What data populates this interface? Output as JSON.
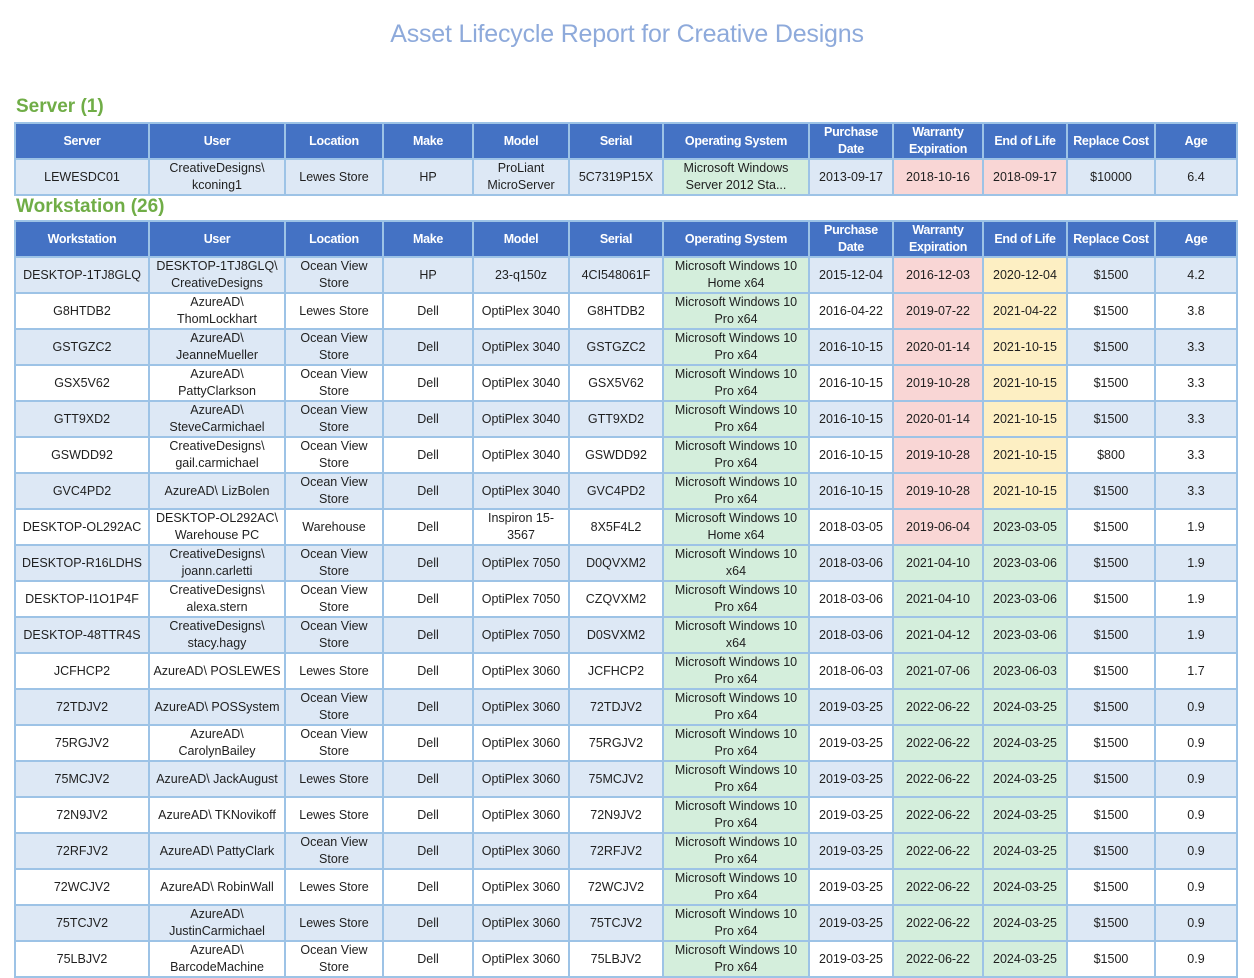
{
  "title": "Asset Lifecycle Report for Creative Designs",
  "colors": {
    "header_bg": "#4472c4",
    "title": "#8eaadb",
    "section": "#70ad47",
    "red": "#f9d6d5",
    "yellow": "#fdefc3",
    "green": "#d4eedc"
  },
  "server_section": {
    "heading": "Server (1)",
    "columns": [
      "Server",
      "User",
      "Location",
      "Make",
      "Model",
      "Serial",
      "Operating System",
      "Purchase Date",
      "Warranty Expiration",
      "End of Life",
      "Replace Cost",
      "Age"
    ],
    "rows": [
      {
        "name": "LEWESDC01",
        "user": "CreativeDesigns\\ kconing1",
        "location": "Lewes Store",
        "make": "HP",
        "model": "ProLiant MicroServer",
        "serial": "5C7319P15X",
        "os": "Microsoft Windows Server 2012 Sta...",
        "purchase": "2013-09-17",
        "warranty": "2018-10-16",
        "warranty_status": "red",
        "eol": "2018-09-17",
        "eol_status": "red",
        "cost": "$10000",
        "age": "6.4"
      }
    ]
  },
  "workstation_section": {
    "heading": "Workstation (26)",
    "columns": [
      "Workstation",
      "User",
      "Location",
      "Make",
      "Model",
      "Serial",
      "Operating System",
      "Purchase Date",
      "Warranty Expiration",
      "End of Life",
      "Replace Cost",
      "Age"
    ],
    "rows": [
      {
        "name": "DESKTOP-1TJ8GLQ",
        "user": "DESKTOP-1TJ8GLQ\\ CreativeDesigns",
        "location": "Ocean View Store",
        "make": "HP",
        "model": "23-q150z",
        "serial": "4CI548061F",
        "os": "Microsoft Windows 10 Home x64",
        "purchase": "2015-12-04",
        "warranty": "2016-12-03",
        "warranty_status": "red",
        "eol": "2020-12-04",
        "eol_status": "yel",
        "cost": "$1500",
        "age": "4.2"
      },
      {
        "name": "G8HTDB2",
        "user": "AzureAD\\ ThomLockhart",
        "location": "Lewes Store",
        "make": "Dell",
        "model": "OptiPlex 3040",
        "serial": "G8HTDB2",
        "os": "Microsoft Windows 10 Pro x64",
        "purchase": "2016-04-22",
        "warranty": "2019-07-22",
        "warranty_status": "red",
        "eol": "2021-04-22",
        "eol_status": "yel",
        "cost": "$1500",
        "age": "3.8"
      },
      {
        "name": "GSTGZC2",
        "user": "AzureAD\\ JeanneMueller",
        "location": "Ocean View Store",
        "make": "Dell",
        "model": "OptiPlex 3040",
        "serial": "GSTGZC2",
        "os": "Microsoft Windows 10 Pro x64",
        "purchase": "2016-10-15",
        "warranty": "2020-01-14",
        "warranty_status": "red",
        "eol": "2021-10-15",
        "eol_status": "yel",
        "cost": "$1500",
        "age": "3.3"
      },
      {
        "name": "GSX5V62",
        "user": "AzureAD\\ PattyClarkson",
        "location": "Ocean View Store",
        "make": "Dell",
        "model": "OptiPlex 3040",
        "serial": "GSX5V62",
        "os": "Microsoft Windows 10 Pro x64",
        "purchase": "2016-10-15",
        "warranty": "2019-10-28",
        "warranty_status": "red",
        "eol": "2021-10-15",
        "eol_status": "yel",
        "cost": "$1500",
        "age": "3.3"
      },
      {
        "name": "GTT9XD2",
        "user": "AzureAD\\ SteveCarmichael",
        "location": "Ocean View Store",
        "make": "Dell",
        "model": "OptiPlex 3040",
        "serial": "GTT9XD2",
        "os": "Microsoft Windows 10 Pro x64",
        "purchase": "2016-10-15",
        "warranty": "2020-01-14",
        "warranty_status": "red",
        "eol": "2021-10-15",
        "eol_status": "yel",
        "cost": "$1500",
        "age": "3.3"
      },
      {
        "name": "GSWDD92",
        "user": "CreativeDesigns\\ gail.carmichael",
        "location": "Ocean View Store",
        "make": "Dell",
        "model": "OptiPlex 3040",
        "serial": "GSWDD92",
        "os": "Microsoft Windows 10 Pro x64",
        "purchase": "2016-10-15",
        "warranty": "2019-10-28",
        "warranty_status": "red",
        "eol": "2021-10-15",
        "eol_status": "yel",
        "cost": "$800",
        "age": "3.3"
      },
      {
        "name": "GVC4PD2",
        "user": "AzureAD\\ LizBolen",
        "location": "Ocean View Store",
        "make": "Dell",
        "model": "OptiPlex 3040",
        "serial": "GVC4PD2",
        "os": "Microsoft Windows 10 Pro x64",
        "purchase": "2016-10-15",
        "warranty": "2019-10-28",
        "warranty_status": "red",
        "eol": "2021-10-15",
        "eol_status": "yel",
        "cost": "$1500",
        "age": "3.3"
      },
      {
        "name": "DESKTOP-OL292AC",
        "user": "DESKTOP-OL292AC\\ Warehouse PC",
        "location": "Warehouse",
        "make": "Dell",
        "model": "Inspiron 15-3567",
        "serial": "8X5F4L2",
        "os": "Microsoft Windows 10 Home x64",
        "purchase": "2018-03-05",
        "warranty": "2019-06-04",
        "warranty_status": "red",
        "eol": "2023-03-05",
        "eol_status": "grn",
        "cost": "$1500",
        "age": "1.9"
      },
      {
        "name": "DESKTOP-R16LDHS",
        "user": "CreativeDesigns\\ joann.carletti",
        "location": "Ocean View Store",
        "make": "Dell",
        "model": "OptiPlex 7050",
        "serial": "D0QVXM2",
        "os": "Microsoft Windows 10 x64",
        "purchase": "2018-03-06",
        "warranty": "2021-04-10",
        "warranty_status": "grn",
        "eol": "2023-03-06",
        "eol_status": "grn",
        "cost": "$1500",
        "age": "1.9"
      },
      {
        "name": "DESKTOP-I1O1P4F",
        "user": "CreativeDesigns\\ alexa.stern",
        "location": "Ocean View Store",
        "make": "Dell",
        "model": "OptiPlex 7050",
        "serial": "CZQVXM2",
        "os": "Microsoft Windows 10 Pro x64",
        "purchase": "2018-03-06",
        "warranty": "2021-04-10",
        "warranty_status": "grn",
        "eol": "2023-03-06",
        "eol_status": "grn",
        "cost": "$1500",
        "age": "1.9"
      },
      {
        "name": "DESKTOP-48TTR4S",
        "user": "CreativeDesigns\\ stacy.hagy",
        "location": "Ocean View Store",
        "make": "Dell",
        "model": "OptiPlex 7050",
        "serial": "D0SVXM2",
        "os": "Microsoft Windows 10 x64",
        "purchase": "2018-03-06",
        "warranty": "2021-04-12",
        "warranty_status": "grn",
        "eol": "2023-03-06",
        "eol_status": "grn",
        "cost": "$1500",
        "age": "1.9"
      },
      {
        "name": "JCFHCP2",
        "user": "AzureAD\\ POSLEWES",
        "location": "Lewes Store",
        "make": "Dell",
        "model": "OptiPlex 3060",
        "serial": "JCFHCP2",
        "os": "Microsoft Windows 10 Pro x64",
        "purchase": "2018-06-03",
        "warranty": "2021-07-06",
        "warranty_status": "grn",
        "eol": "2023-06-03",
        "eol_status": "grn",
        "cost": "$1500",
        "age": "1.7"
      },
      {
        "name": "72TDJV2",
        "user": "AzureAD\\ POSSystem",
        "location": "Ocean View Store",
        "make": "Dell",
        "model": "OptiPlex 3060",
        "serial": "72TDJV2",
        "os": "Microsoft Windows 10 Pro x64",
        "purchase": "2019-03-25",
        "warranty": "2022-06-22",
        "warranty_status": "grn",
        "eol": "2024-03-25",
        "eol_status": "grn",
        "cost": "$1500",
        "age": "0.9"
      },
      {
        "name": "75RGJV2",
        "user": "AzureAD\\ CarolynBailey",
        "location": "Ocean View Store",
        "make": "Dell",
        "model": "OptiPlex 3060",
        "serial": "75RGJV2",
        "os": "Microsoft Windows 10 Pro x64",
        "purchase": "2019-03-25",
        "warranty": "2022-06-22",
        "warranty_status": "grn",
        "eol": "2024-03-25",
        "eol_status": "grn",
        "cost": "$1500",
        "age": "0.9"
      },
      {
        "name": "75MCJV2",
        "user": "AzureAD\\ JackAugust",
        "location": "Lewes Store",
        "make": "Dell",
        "model": "OptiPlex 3060",
        "serial": "75MCJV2",
        "os": "Microsoft Windows 10 Pro x64",
        "purchase": "2019-03-25",
        "warranty": "2022-06-22",
        "warranty_status": "grn",
        "eol": "2024-03-25",
        "eol_status": "grn",
        "cost": "$1500",
        "age": "0.9"
      },
      {
        "name": "72N9JV2",
        "user": "AzureAD\\ TKNovikoff",
        "location": "Lewes Store",
        "make": "Dell",
        "model": "OptiPlex 3060",
        "serial": "72N9JV2",
        "os": "Microsoft Windows 10 Pro x64",
        "purchase": "2019-03-25",
        "warranty": "2022-06-22",
        "warranty_status": "grn",
        "eol": "2024-03-25",
        "eol_status": "grn",
        "cost": "$1500",
        "age": "0.9"
      },
      {
        "name": "72RFJV2",
        "user": "AzureAD\\ PattyClark",
        "location": "Ocean View Store",
        "make": "Dell",
        "model": "OptiPlex 3060",
        "serial": "72RFJV2",
        "os": "Microsoft Windows 10 Pro x64",
        "purchase": "2019-03-25",
        "warranty": "2022-06-22",
        "warranty_status": "grn",
        "eol": "2024-03-25",
        "eol_status": "grn",
        "cost": "$1500",
        "age": "0.9"
      },
      {
        "name": "72WCJV2",
        "user": "AzureAD\\ RobinWall",
        "location": "Lewes Store",
        "make": "Dell",
        "model": "OptiPlex 3060",
        "serial": "72WCJV2",
        "os": "Microsoft Windows 10 Pro x64",
        "purchase": "2019-03-25",
        "warranty": "2022-06-22",
        "warranty_status": "grn",
        "eol": "2024-03-25",
        "eol_status": "grn",
        "cost": "$1500",
        "age": "0.9"
      },
      {
        "name": "75TCJV2",
        "user": "AzureAD\\ JustinCarmichael",
        "location": "Lewes Store",
        "make": "Dell",
        "model": "OptiPlex 3060",
        "serial": "75TCJV2",
        "os": "Microsoft Windows 10 Pro x64",
        "purchase": "2019-03-25",
        "warranty": "2022-06-22",
        "warranty_status": "grn",
        "eol": "2024-03-25",
        "eol_status": "grn",
        "cost": "$1500",
        "age": "0.9"
      },
      {
        "name": "75LBJV2",
        "user": "AzureAD\\ BarcodeMachine",
        "location": "Ocean View Store",
        "make": "Dell",
        "model": "OptiPlex 3060",
        "serial": "75LBJV2",
        "os": "Microsoft Windows 10 Pro x64",
        "purchase": "2019-03-25",
        "warranty": "2022-06-22",
        "warranty_status": "grn",
        "eol": "2024-03-25",
        "eol_status": "grn",
        "cost": "$1500",
        "age": "0.9"
      }
    ]
  }
}
